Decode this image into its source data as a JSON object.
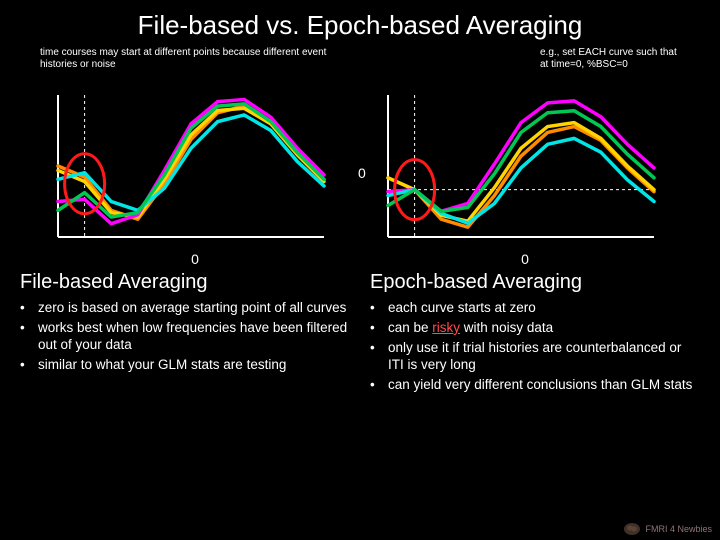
{
  "title": "File-based vs. Epoch-based Averaging",
  "left_note": "time courses may start at different points because different event histories or noise",
  "right_note": "e.g., set EACH curve such that at time=0, %BSC=0",
  "zero": "0",
  "left_heading": "File-based Averaging",
  "right_heading": "Epoch-based Averaging",
  "left_bullets": [
    "zero is based on average starting point of all curves",
    "works best when low frequencies have been filtered out of your data",
    "similar to what your GLM stats are testing"
  ],
  "right_bullets": [
    "each curve starts at zero",
    "can be |risky| with noisy data",
    "only use it if trial histories are counterbalanced or ITI is very long",
    "can yield very different conclusions than GLM stats"
  ],
  "logo_text": "FMRI 4 Newbies",
  "chart_data": [
    {
      "type": "line",
      "title": "File-based Averaging",
      "xlim": [
        0,
        10
      ],
      "ylim": [
        -1,
        2.2
      ],
      "x_zero_marker": 1,
      "series": [
        {
          "name": "orange",
          "color": "#ff8c00",
          "x": [
            0,
            1,
            2,
            3,
            4,
            5,
            6,
            7,
            8,
            9,
            10
          ],
          "values": [
            0.6,
            0.35,
            -0.4,
            -0.6,
            0.2,
            1.2,
            1.8,
            1.95,
            1.6,
            0.9,
            0.3
          ]
        },
        {
          "name": "yellow",
          "color": "#ffd400",
          "x": [
            0,
            1,
            2,
            3,
            4,
            5,
            6,
            7,
            8,
            9,
            10
          ],
          "values": [
            0.5,
            0.25,
            -0.45,
            -0.55,
            0.3,
            1.3,
            1.85,
            1.9,
            1.55,
            0.85,
            0.25
          ]
        },
        {
          "name": "magenta",
          "color": "#ff00ff",
          "x": [
            0,
            1,
            2,
            3,
            4,
            5,
            6,
            7,
            8,
            9,
            10
          ],
          "values": [
            -0.2,
            -0.15,
            -0.7,
            -0.5,
            0.5,
            1.55,
            2.05,
            2.1,
            1.7,
            1.0,
            0.4
          ]
        },
        {
          "name": "cyan",
          "color": "#00e5e5",
          "x": [
            0,
            1,
            2,
            3,
            4,
            5,
            6,
            7,
            8,
            9,
            10
          ],
          "values": [
            0.3,
            0.45,
            -0.2,
            -0.4,
            0.1,
            1.0,
            1.6,
            1.75,
            1.4,
            0.7,
            0.15
          ]
        },
        {
          "name": "green",
          "color": "#00c853",
          "x": [
            0,
            1,
            2,
            3,
            4,
            5,
            6,
            7,
            8,
            9,
            10
          ],
          "values": [
            -0.4,
            0.0,
            -0.55,
            -0.45,
            0.4,
            1.45,
            1.95,
            2.0,
            1.6,
            0.9,
            0.3
          ]
        }
      ]
    },
    {
      "type": "line",
      "title": "Epoch-based Averaging",
      "xlim": [
        0,
        10
      ],
      "ylim": [
        -1.2,
        2.4
      ],
      "x_zero_marker": 1,
      "y_zero_line": 0,
      "series": [
        {
          "name": "orange",
          "color": "#ff8c00",
          "x": [
            0,
            1,
            2,
            3,
            4,
            5,
            6,
            7,
            8,
            9,
            10
          ],
          "values": [
            0.3,
            0.0,
            -0.75,
            -0.95,
            -0.15,
            0.85,
            1.45,
            1.6,
            1.25,
            0.55,
            -0.05
          ]
        },
        {
          "name": "yellow",
          "color": "#ffd400",
          "x": [
            0,
            1,
            2,
            3,
            4,
            5,
            6,
            7,
            8,
            9,
            10
          ],
          "values": [
            0.3,
            0.0,
            -0.65,
            -0.8,
            0.05,
            1.05,
            1.6,
            1.7,
            1.3,
            0.6,
            0.0
          ]
        },
        {
          "name": "magenta",
          "color": "#ff00ff",
          "x": [
            0,
            1,
            2,
            3,
            4,
            5,
            6,
            7,
            8,
            9,
            10
          ],
          "values": [
            -0.05,
            0.0,
            -0.55,
            -0.35,
            0.65,
            1.7,
            2.2,
            2.25,
            1.85,
            1.15,
            0.55
          ]
        },
        {
          "name": "cyan",
          "color": "#00e5e5",
          "x": [
            0,
            1,
            2,
            3,
            4,
            5,
            6,
            7,
            8,
            9,
            10
          ],
          "values": [
            -0.15,
            0.0,
            -0.6,
            -0.85,
            -0.35,
            0.55,
            1.15,
            1.3,
            0.95,
            0.25,
            -0.3
          ]
        },
        {
          "name": "green",
          "color": "#00c853",
          "x": [
            0,
            1,
            2,
            3,
            4,
            5,
            6,
            7,
            8,
            9,
            10
          ],
          "values": [
            -0.4,
            0.0,
            -0.55,
            -0.45,
            0.4,
            1.45,
            1.95,
            2.0,
            1.6,
            0.9,
            0.3
          ]
        }
      ]
    }
  ]
}
